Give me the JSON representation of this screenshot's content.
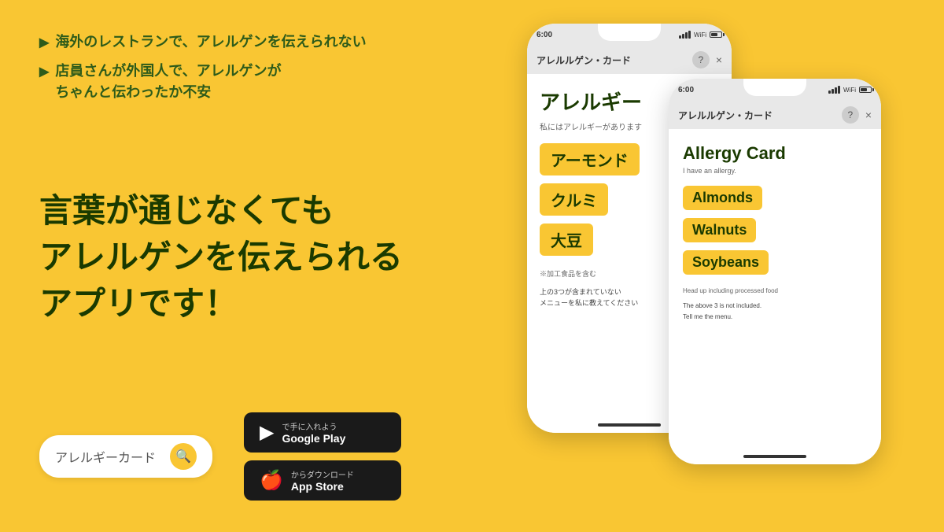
{
  "background_color": "#F9C633",
  "problems": {
    "item1": "海外のレストランで、アレルゲンを伝えられない",
    "item2": "店員さんが外国人で、アレルゲンが\nちゃんと伝わったか不安"
  },
  "tagline": {
    "line1": "言葉が通じなくても",
    "line2": "アレルゲンを伝えられる",
    "line3": "アプリです！"
  },
  "search": {
    "text": "アレルギーカード",
    "placeholder": "アレルギーカード"
  },
  "google_play": {
    "sub": "で手に入れよう",
    "main": "Google Play"
  },
  "app_store": {
    "sub": "からダウンロード",
    "main": "App Store"
  },
  "phone_back": {
    "status_time": "6:00",
    "header_title": "アレルルゲン・カード",
    "close": "×",
    "content": {
      "title": "アレルギー",
      "subtitle": "私にはアレルギーがあります",
      "items": [
        "アーモンド",
        "クルミ",
        "大豆"
      ],
      "note": "※加工食品を含む",
      "request": "上の3つが含まれていない\nメニューを私に教えてください"
    }
  },
  "phone_front": {
    "status_time": "6:00",
    "header_title": "アレルルゲン・カード",
    "close": "×",
    "content": {
      "title": "Allergy Card",
      "subtitle": "I have an allergy.",
      "items": [
        "Almonds",
        "Walnuts",
        "Soybeans"
      ],
      "note": "Head up including processed food",
      "request": "The above 3 is not included.\nTell me the menu."
    }
  }
}
